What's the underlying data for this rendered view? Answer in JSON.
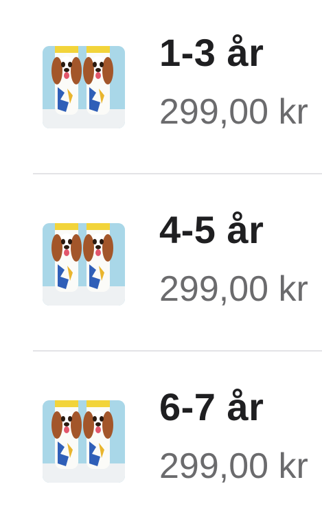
{
  "products": [
    {
      "size": "1-3 år",
      "price": "299,00 kr",
      "image_icon": "dog-socks-product-image"
    },
    {
      "size": "4-5 år",
      "price": "299,00 kr",
      "image_icon": "dog-socks-product-image"
    },
    {
      "size": "6-7 år",
      "price": "299,00 kr",
      "image_icon": "dog-socks-product-image"
    }
  ],
  "colors": {
    "title": "#1f1f21",
    "price": "#6b6b6d",
    "divider": "#e3e3e6",
    "thumb_background": "#a9d7e8"
  }
}
